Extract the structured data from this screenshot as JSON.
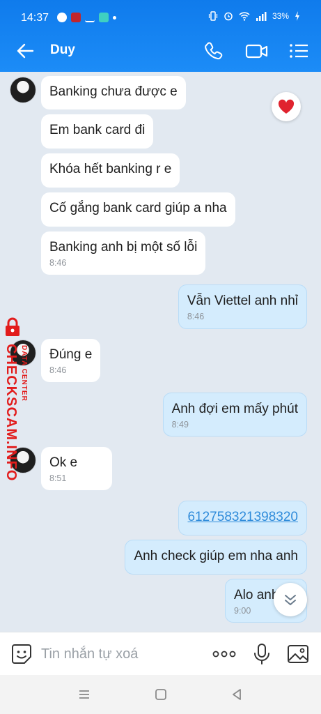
{
  "status_bar": {
    "time": "14:37",
    "battery": "33%"
  },
  "header": {
    "contact_name": "Duy",
    "back_icon": "arrow-left-icon",
    "actions": [
      "phone-icon",
      "video-camera-icon",
      "menu-list-icon"
    ]
  },
  "messages": [
    {
      "direction": "in",
      "text": "Banking chưa được e",
      "time": ""
    },
    {
      "direction": "in",
      "text": "Em bank card đi",
      "time": ""
    },
    {
      "direction": "in",
      "text": "Khóa hết banking r e",
      "time": ""
    },
    {
      "direction": "in",
      "text": "Cố gắng bank card giúp a nha",
      "time": ""
    },
    {
      "direction": "in",
      "text": "Banking anh bị một số lỗi",
      "time": "8:46"
    },
    {
      "direction": "out",
      "text": "Vẫn Viettel anh nhỉ",
      "time": "8:46"
    },
    {
      "direction": "in",
      "text": "Đúng e",
      "time": "8:46"
    },
    {
      "direction": "out",
      "text": "Anh đợi em mấy phút",
      "time": "8:49"
    },
    {
      "direction": "in",
      "text": "Ok e",
      "time": "8:51"
    },
    {
      "direction": "out",
      "text": "612758321398320",
      "time": "",
      "is_link": true
    },
    {
      "direction": "out",
      "text": "Anh check giúp em nha anh",
      "time": ""
    },
    {
      "direction": "out",
      "text": "Alo anh",
      "time": "9:00"
    }
  ],
  "reaction": "heart-icon",
  "watermark": {
    "line1": "CHECKSCAM.INFO",
    "line2": "DATA CENTER"
  },
  "composer": {
    "placeholder": "Tin nhắn tự xoá"
  },
  "colors": {
    "header": "#1c8cf7",
    "background": "#e2e9f1",
    "outgoing_bubble": "#d4ecfd",
    "watermark": "#e21c1c"
  }
}
